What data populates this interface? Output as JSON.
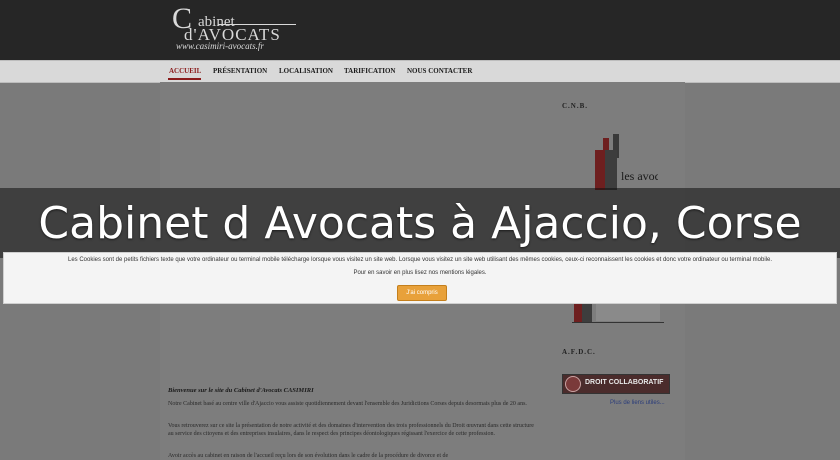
{
  "logo": {
    "big_letter": "C",
    "word1": "abinet",
    "word2": "d'AVOCATS",
    "url": "www.casimiri-avocats.fr"
  },
  "nav": {
    "items": [
      "ACCUEIL",
      "PRÉSENTATION",
      "LOCALISATION",
      "TARIFICATION",
      "NOUS CONTACTER"
    ],
    "active_index": 0
  },
  "banner": {
    "title": "Cabinet d Avocats à Ajaccio, Corse"
  },
  "cookie": {
    "text": "Les Cookies sont de petits fichiers texte que votre ordinateur ou terminal mobile télécharge lorsque vous visitez un site web. Lorsque vous visitez un site web utilisant des mêmes cookies, ceux-ci reconnaissent les cookies et donc votre ordinateur ou terminal mobile.",
    "more_prefix": "Pour en savoir en plus lisez ",
    "more_link": "nos mentions légales.",
    "button": "J'ai compris"
  },
  "sidebar": {
    "cnb_heading": "C.N.B.",
    "cnb_logo_text": "les avocats",
    "afdc_heading": "A.F.D.C.",
    "droit_badge": "DROIT COLLABORATIF",
    "more_link": "Plus de liens utiles..."
  },
  "article": {
    "title": "Bienvenue sur le site du Cabinet d'Avocats CASIMIRI",
    "paragraphs": [
      "Notre Cabinet basé au centre ville d'Ajaccio vous assiste quotidiennement devant l'ensemble des Juridictions Corses depuis desormais plus de 20 ans.",
      "Vous retrouverez sur ce site la présentation de notre activité et des domaines d'intervention des trois professionnels du Droit œuvrant dans cette structure au service des citoyens et des entreprises insulaires, dans le respect des principes déontologiques régissant l'exercice de cette profession.",
      "Avoir accès au cabinet en raison de l'accueil reçu lors de son évolution dans le cadre de la procédure de divorce et de"
    ]
  }
}
